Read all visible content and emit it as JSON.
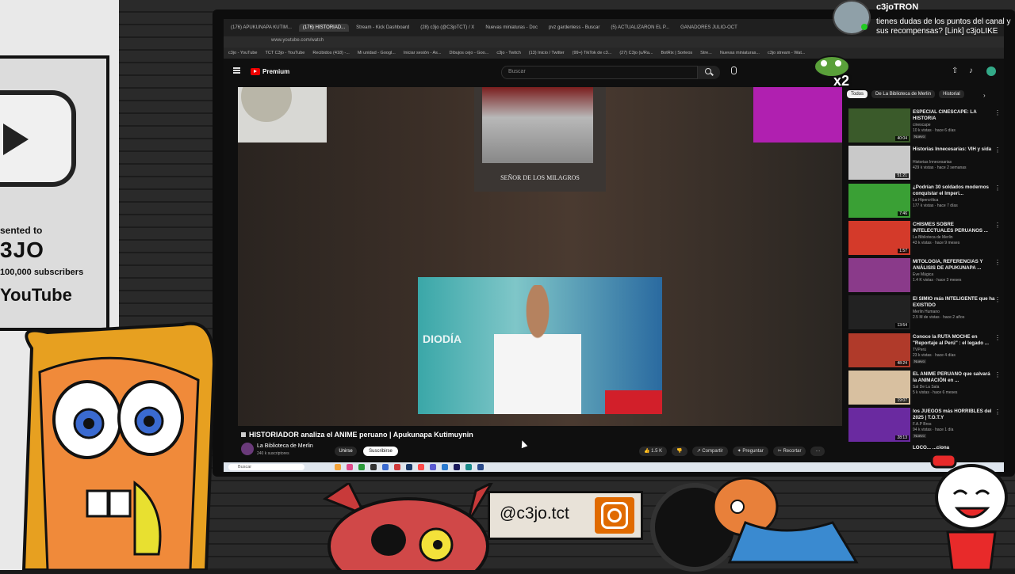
{
  "plaque": {
    "line1": "sented to",
    "line2": "3JO",
    "line3": "100,000 subscribers",
    "line4": "YouTube"
  },
  "browser": {
    "tabs": [
      {
        "label": "(176) APUKUNAPA KUTIM...",
        "active": false
      },
      {
        "label": "(176) HISTORIAD...",
        "active": true
      },
      {
        "label": "Stream - Kick Dashboard",
        "active": false
      },
      {
        "label": "(28) c3jo (@C3joTCT) / X",
        "active": false
      },
      {
        "label": "Nuevas miniaturas - Doc",
        "active": false
      },
      {
        "label": "pvz gardenless - Buscar",
        "active": false
      },
      {
        "label": "(5) ACTUALIZARON EL P...",
        "active": false
      },
      {
        "label": "GANADORES JULIO-OCT",
        "active": false
      }
    ],
    "url": "www.youtube.com/watch",
    "bookmarks": [
      "c3jo - YouTube",
      "TCT C3jo - YouTube",
      "Recibidos (418) -...",
      "Mi unidad - Googl...",
      "Iniciar sesión - As...",
      "Dibujos cejo - Goo...",
      "c3jo - Twitch",
      "(13) Inicio / Twitter",
      "(99+) TikTok de c3...",
      "(27) C3jo (u/Ra...",
      "BotRix | Sorteos",
      "Stre...",
      "Nuevas miniaturas...",
      "c3jo stream - Wat..."
    ]
  },
  "youtube": {
    "brand": "Premium",
    "search_placeholder": "Buscar",
    "altar_caption": "SEÑOR DE LOS MILAGROS",
    "news_text": "DIODÍA",
    "video_title": "HISTORIADOR analiza el ANIME peruano | Apukunapa Kutimuynin",
    "channel": "La Biblioteca de Merlin",
    "subs": "240 k suscriptores",
    "join": "Unirse",
    "subscribe": "Suscribirse",
    "likes": "1.5 K",
    "share": "Compartir",
    "ask": "Preguntar",
    "clip": "Recortar",
    "more": "···",
    "chips": [
      {
        "label": "Todos",
        "active": true
      },
      {
        "label": "De La Biblioteca de Merlin",
        "active": false
      },
      {
        "label": "Historial",
        "active": false
      }
    ],
    "recs": [
      {
        "title": "ESPECIAL CINESCAPE: LA HISTORIA",
        "channel": "cinescape",
        "meta": "10 k vistas · hace 6 días",
        "badge": "Nuevo",
        "dur": "40:04",
        "color": "#3a5a2a"
      },
      {
        "title": "Historias Innecesarias: VIH y sida",
        "channel": "Historias Innecesarias",
        "meta": "429 k vistas · hace 2 semanas",
        "badge": "",
        "dur": "51:21",
        "color": "#c9c9c9"
      },
      {
        "title": "¿Podrían 30 soldados modernos conquistar el Imperi...",
        "channel": "La Hipercrítica",
        "meta": "177 k vistas · hace 7 días",
        "badge": "",
        "dur": "7:46",
        "color": "#3aa035"
      },
      {
        "title": "CHISMES SOBRE INTELECTUALES PERUANOS ...",
        "channel": "La Biblioteca de Merlin",
        "meta": "43 k vistas · hace 9 meses",
        "badge": "",
        "dur": "1:57",
        "color": "#d43a2a"
      },
      {
        "title": "MITOLOGIA, REFERENCIAS Y ANÁLISIS DE APUKUNAPA ...",
        "channel": "Eve Mágica",
        "meta": "1.4 K vistas · hace 3 meses",
        "badge": "",
        "dur": "",
        "color": "#8a3a8a"
      },
      {
        "title": "El SIMIO más INTELIGENTE que ha EXISTIDO",
        "channel": "Merlin Humano",
        "meta": "2.5 M de vistas · hace 2 años",
        "badge": "",
        "dur": "13:54",
        "color": "#222"
      },
      {
        "title": "Conoce la RUTA MOCHE en \"Reportaje al Perú\" : el legado ...",
        "channel": "TVPerú",
        "meta": "23 k vistas · hace 4 días",
        "badge": "Nuevo",
        "dur": "48:24",
        "color": "#b03a2a"
      },
      {
        "title": "EL ANIME PERUANO que salvará la ANIMACIÓN en ...",
        "channel": "Sal De La Sala",
        "meta": "5 k vistas · hace 6 meses",
        "badge": "",
        "dur": "19:07",
        "color": "#d8c0a0"
      },
      {
        "title": "los JUEGOS más HORRIBLES del 2025 | T.O.T.Y",
        "channel": "F.A.P Bros",
        "meta": "94 k vistas · hace 1 día",
        "badge": "Nuevo",
        "dur": "28:13",
        "color": "#6a2aa0"
      }
    ],
    "partial_rec": "LOCO... ...ciona"
  },
  "taskbar": {
    "search": "Buscar"
  },
  "chat": {
    "user": "c3joTRON",
    "message": "tienes dudas de los puntos del canal y sus recompensas? [Link] c3joLIKE"
  },
  "overlay": {
    "multiplier": "x2",
    "instagram": "@c3jo.tct"
  },
  "colors": {
    "youtube_red": "#ff0000",
    "instagram_orange": "#e06a00",
    "yt_bg": "#0f0f0f"
  }
}
